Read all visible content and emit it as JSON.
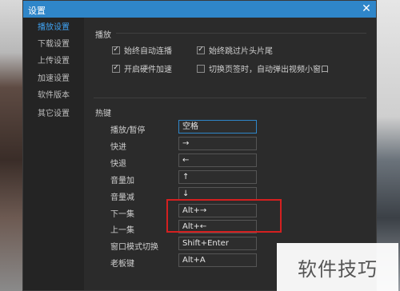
{
  "window": {
    "title": "设置",
    "close_glyph": "✕"
  },
  "sidebar": {
    "items": [
      {
        "label": "播放设置",
        "active": true
      },
      {
        "label": "下载设置",
        "active": false
      },
      {
        "label": "上传设置",
        "active": false
      },
      {
        "label": "加速设置",
        "active": false
      },
      {
        "label": "软件版本",
        "active": false
      },
      {
        "label": "其它设置",
        "active": false
      }
    ]
  },
  "playback": {
    "title": "播放",
    "options": [
      {
        "label": "始终自动连播",
        "checked": true
      },
      {
        "label": "始终跳过片头片尾",
        "checked": true
      },
      {
        "label": "开启硬件加速",
        "checked": true
      },
      {
        "label": "切换页签时，自动弹出视频小窗口",
        "checked": false
      }
    ]
  },
  "hotkeys": {
    "title": "热键",
    "rows": [
      {
        "label": "播放/暂停",
        "value": "空格"
      },
      {
        "label": "快进",
        "value": "→"
      },
      {
        "label": "快退",
        "value": "←"
      },
      {
        "label": "音量加",
        "value": "↑"
      },
      {
        "label": "音量减",
        "value": "↓"
      },
      {
        "label": "下一集",
        "value": "Alt+→"
      },
      {
        "label": "上一集",
        "value": "Alt+←"
      },
      {
        "label": "窗口模式切换",
        "value": "Shift+Enter"
      },
      {
        "label": "老板键",
        "value": "Alt+A"
      }
    ]
  },
  "watermark": {
    "text": "软件技巧"
  },
  "colors": {
    "accent": "#2f86c9",
    "active_nav": "#3fa2f2",
    "highlight": "#d42020"
  }
}
